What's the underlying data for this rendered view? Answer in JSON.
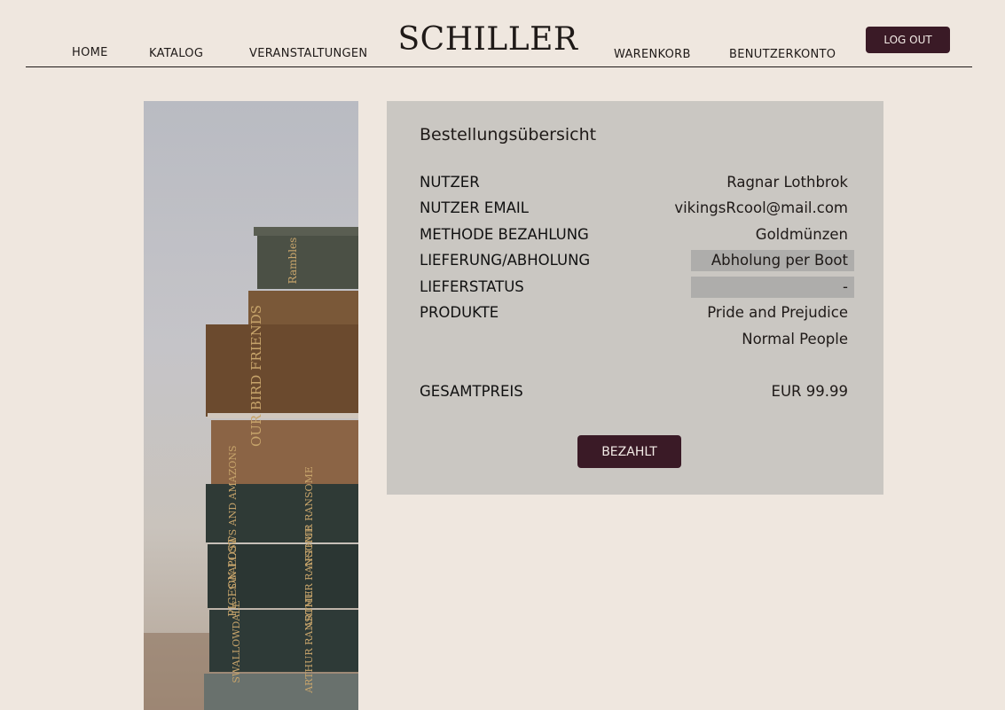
{
  "header": {
    "logo": "SCHILLER",
    "nav": {
      "home": "HOME",
      "katalog": "KATALOG",
      "veranstaltungen": "VERANSTALTUNGEN",
      "warenkorb": "WARENKORB",
      "benutzerkonto": "BENUTZERKONTO"
    },
    "logout_label": "LOG OUT"
  },
  "order": {
    "title": "Bestellungsübersicht",
    "rows": [
      {
        "label": "NUTZER",
        "value": "Ragnar Lothbrok"
      },
      {
        "label": "NUTZER EMAIL",
        "value": "vikingsRcool@mail.com"
      },
      {
        "label": "METHODE BEZAHLUNG",
        "value": "Goldmünzen"
      },
      {
        "label": "LIEFERUNG/ABHOLUNG",
        "value": "Abholung per Boot"
      },
      {
        "label": "LIEFERSTATUS",
        "value": "-"
      },
      {
        "label": "PRODUKTE",
        "value": "Pride and Prejudice"
      }
    ],
    "extra_product": "Normal People",
    "total_label": "GESAMTPREIS",
    "total_value": "EUR 99.99",
    "paid_label": "BEZAHLT"
  },
  "photo": {
    "book_spines": [
      "OUR BIRD FRIENDS",
      "SWALLOWS AND AMAZONS",
      "ARTHUR RANSOME",
      "PIGEON POST",
      "ARTHUR RANSOME",
      "SWALLOWDALE",
      "ARTHUR RANSOME",
      "Rambles"
    ]
  },
  "colors": {
    "background": "#efe7df",
    "panel": "#cac7c2",
    "accent": "#3a1a26",
    "highlight_box": "#aeadab"
  }
}
